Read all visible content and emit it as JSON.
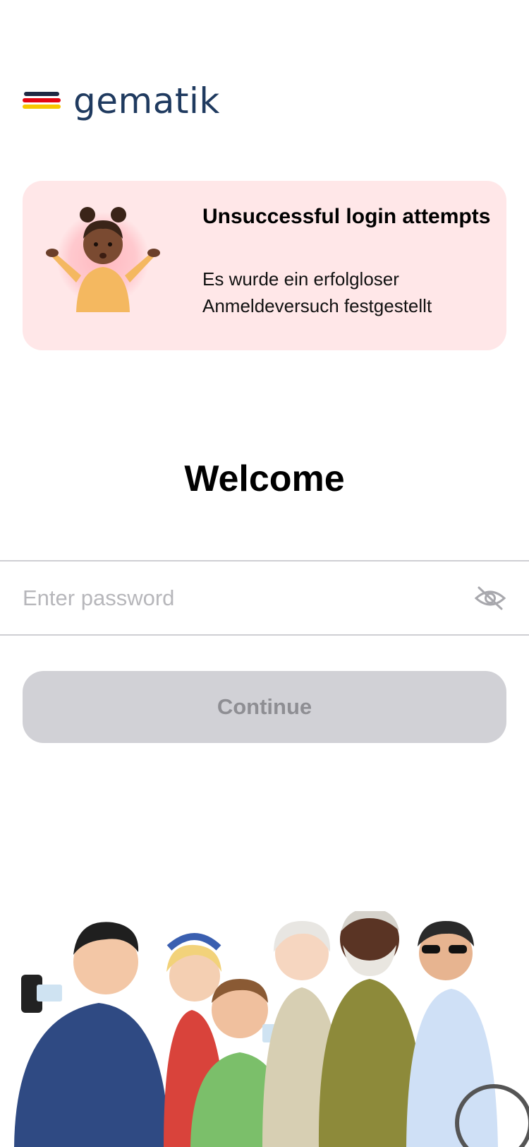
{
  "brand": {
    "name": "gematik"
  },
  "alert": {
    "title": "Unsuccessful login attempts",
    "message": "Es wurde ein erfolgloser Anmeldeversuch festgestellt",
    "icon": "shrugging-person-illustration"
  },
  "welcome": {
    "title": "Welcome"
  },
  "password": {
    "placeholder": "Enter password",
    "value": "",
    "toggle_icon": "eye-slash-icon"
  },
  "continue_button": {
    "label": "Continue",
    "enabled": false
  },
  "colors": {
    "alert_bg": "#ffe7e8",
    "button_disabled_bg": "#d1d1d6",
    "button_disabled_text": "#8e8e93",
    "brand_text": "#1f3a5f"
  }
}
